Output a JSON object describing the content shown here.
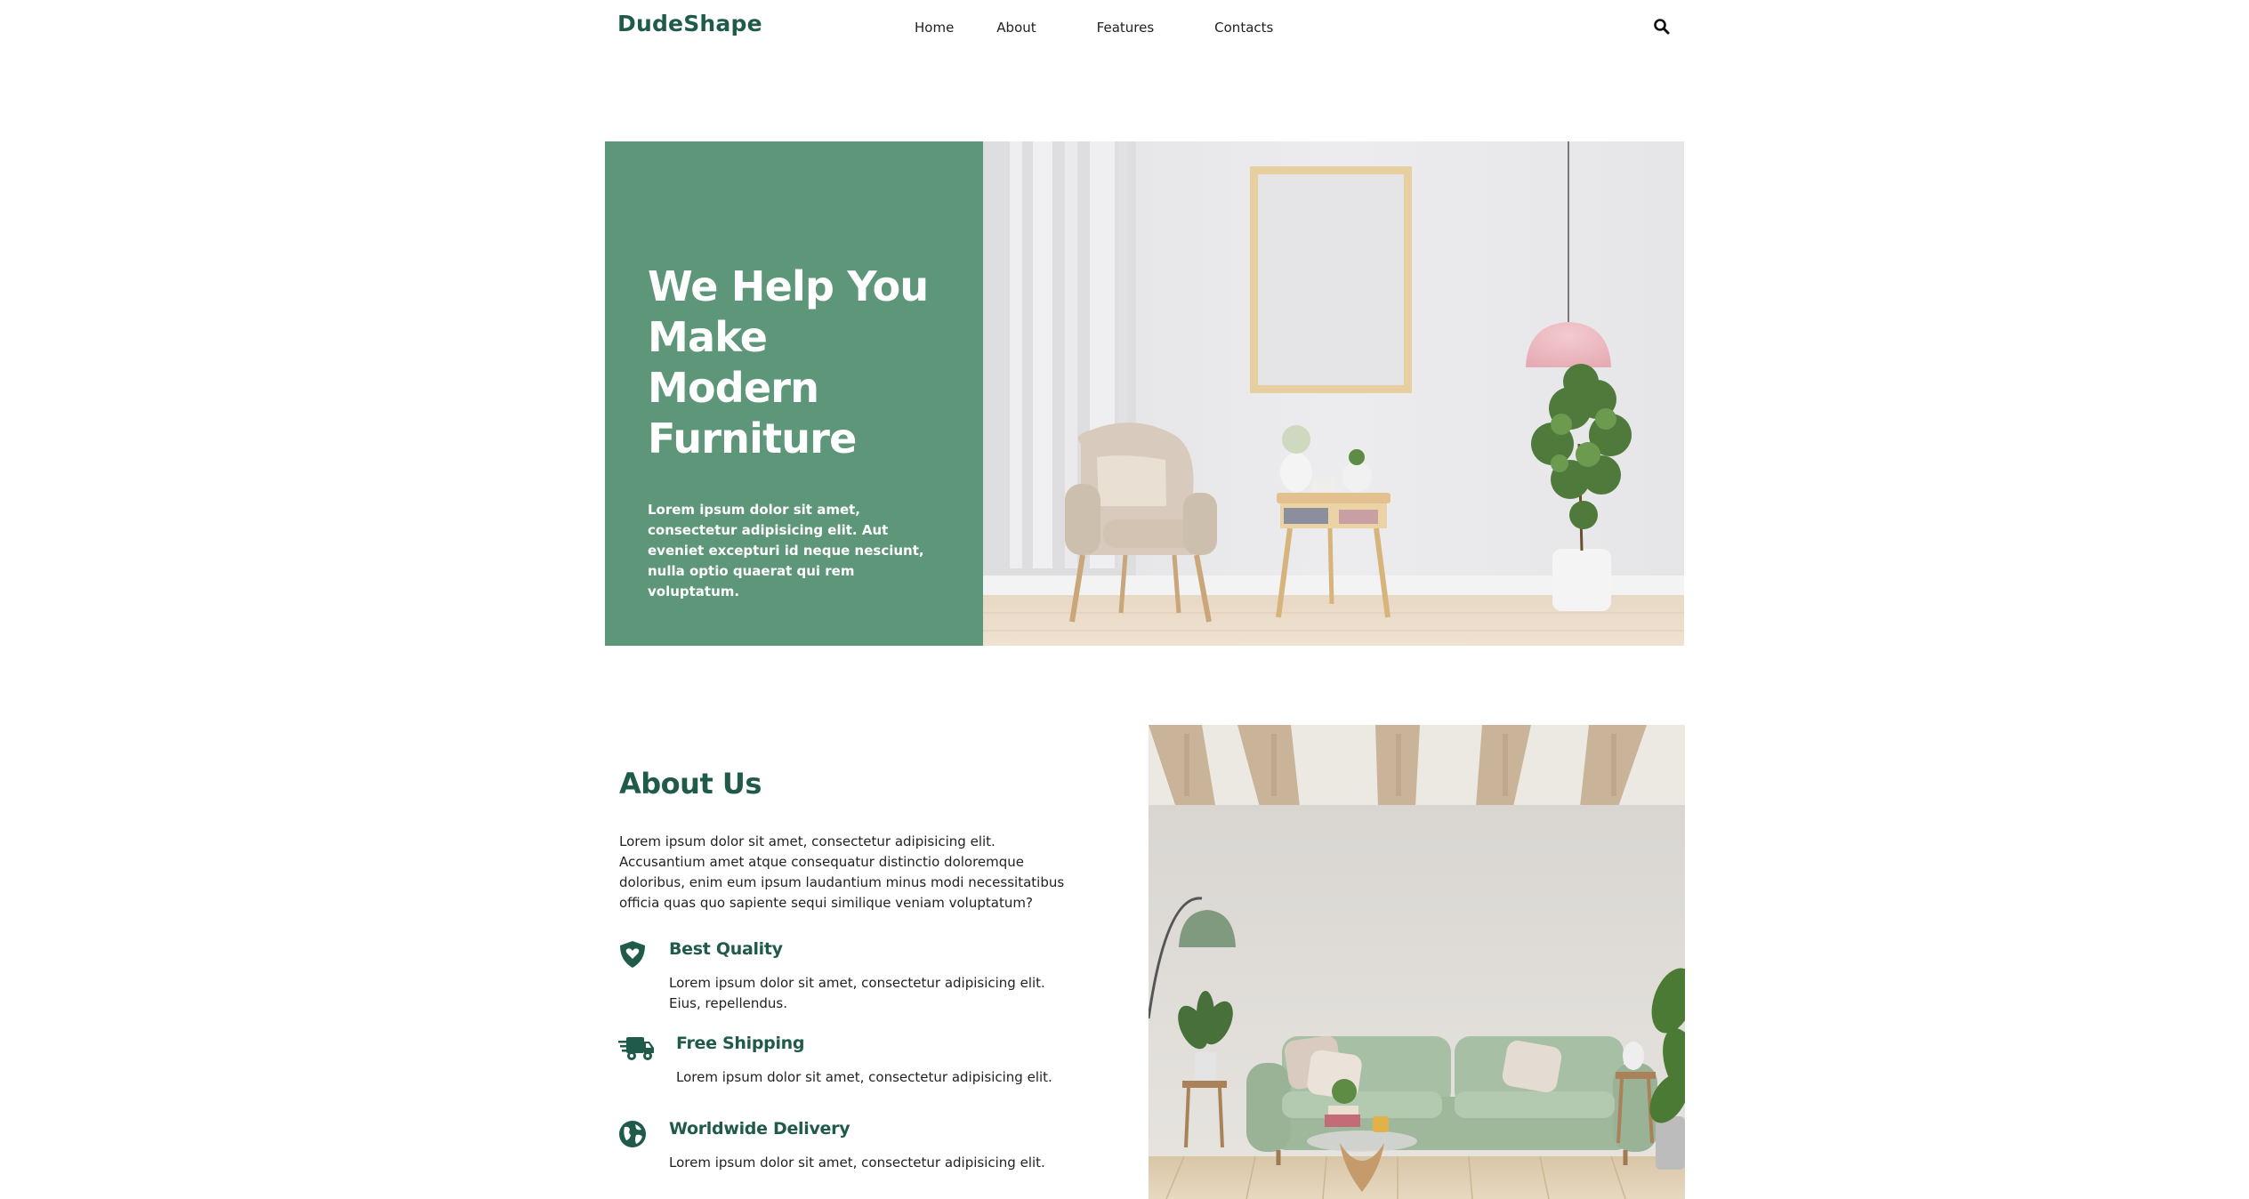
{
  "header": {
    "logo": "DudeShape",
    "nav": [
      {
        "label": "Home"
      },
      {
        "label": "About"
      },
      {
        "label": "Features"
      },
      {
        "label": "Contacts"
      }
    ],
    "search_icon": "search-icon"
  },
  "hero": {
    "title_lines": [
      "We Help You",
      "Make Modern",
      "Furniture"
    ],
    "text": "Lorem ipsum dolor sit amet, consectetur adipisicing elit. Aut eveniet excepturi id neque nesciunt, nulla optio quaerat qui rem voluptatum.",
    "panel_color": "#5e9679",
    "image": "living-room-armchair-side-table-plant-photo"
  },
  "about": {
    "title": "About Us",
    "text": "Lorem ipsum dolor sit amet, consectetur adipisicing elit. Accusantium amet atque consequatur distinctio doloremque doloribus, enim eum ipsum laudantium minus modi necessitatibus officia quas quo sapiente sequi similique veniam voluptatum?",
    "features": [
      {
        "icon": "shield-heart-icon",
        "title": "Best Quality",
        "text": "Lorem ipsum dolor sit amet, consectetur adipisicing elit. Eius, repellendus."
      },
      {
        "icon": "shipping-truck-icon",
        "title": "Free Shipping",
        "text": "Lorem ipsum dolor sit amet, consectetur adipisicing elit."
      },
      {
        "icon": "globe-icon",
        "title": "Worldwide Delivery",
        "text": "Lorem ipsum dolor sit amet, consectetur adipisicing elit."
      }
    ],
    "image": "green-sofa-living-room-photo",
    "accent_color": "#1f5a4a"
  }
}
